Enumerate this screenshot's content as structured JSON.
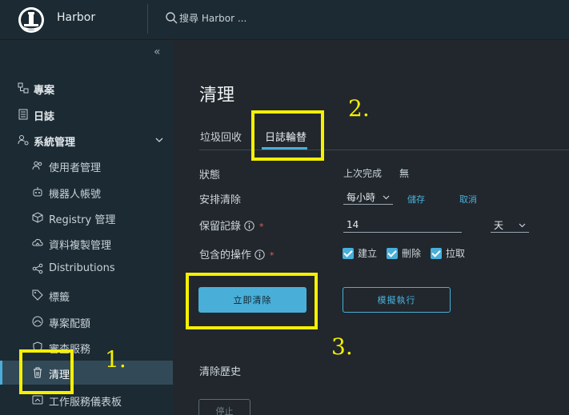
{
  "header": {
    "app_title": "Harbor",
    "search_placeholder": "搜尋 Harbor ..."
  },
  "sidebar": {
    "collapse_glyph": "«",
    "items": [
      {
        "label": "專案",
        "icon": "projects-icon"
      },
      {
        "label": "日誌",
        "icon": "logs-icon"
      },
      {
        "label": "系統管理",
        "icon": "admin-icon",
        "expanded": true
      },
      {
        "label": "使用者管理",
        "icon": "users-icon"
      },
      {
        "label": "機器人帳號",
        "icon": "robot-icon"
      },
      {
        "label": "Registry 管理",
        "icon": "registry-icon"
      },
      {
        "label": "資料複製管理",
        "icon": "replication-icon"
      },
      {
        "label": "Distributions",
        "icon": "distributions-icon"
      },
      {
        "label": "標籤",
        "icon": "labels-icon"
      },
      {
        "label": "專案配額",
        "icon": "quota-icon"
      },
      {
        "label": "審查服務",
        "icon": "interrogation-icon"
      },
      {
        "label": "清理",
        "icon": "trash-icon",
        "active": true
      },
      {
        "label": "工作服務儀表板",
        "icon": "dashboard-icon"
      }
    ]
  },
  "main": {
    "title": "清理",
    "tabs": [
      {
        "label": "垃圾回收",
        "active": false
      },
      {
        "label": "日誌輪替",
        "active": true
      }
    ],
    "status": {
      "label": "狀態",
      "last_completed_label": "上次完成",
      "last_completed_value": "無"
    },
    "schedule": {
      "label": "安排清除",
      "value": "每小時",
      "save_label": "儲存",
      "cancel_label": "取消"
    },
    "retention": {
      "label": "保留記錄",
      "value": "14",
      "unit": "天"
    },
    "operations": {
      "label": "包含的操作",
      "options": [
        {
          "label": "建立",
          "checked": true
        },
        {
          "label": "刪除",
          "checked": true
        },
        {
          "label": "拉取",
          "checked": true
        }
      ]
    },
    "purge_now_label": "立即清除",
    "dry_run_label": "模擬執行",
    "history_title": "清除歷史",
    "stop_label": "停止"
  },
  "annotations": [
    {
      "number": "1."
    },
    {
      "number": "2."
    },
    {
      "number": "3."
    }
  ],
  "colors": {
    "accent": "#49afd9",
    "header_bg": "#1b2a33",
    "sidebar_bg": "#1c2a33",
    "content_bg": "#21272c",
    "annotation": "#f5f000",
    "required": "#e25e5e"
  }
}
